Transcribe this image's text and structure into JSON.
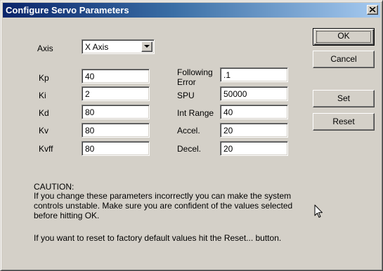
{
  "window": {
    "title": "Configure Servo Parameters"
  },
  "axis": {
    "label": "Axis",
    "value": "X Axis"
  },
  "left_params": [
    {
      "label": "Kp",
      "value": "40"
    },
    {
      "label": "Ki",
      "value": "2"
    },
    {
      "label": "Kd",
      "value": "80"
    },
    {
      "label": "Kv",
      "value": "80"
    },
    {
      "label": "Kvff",
      "value": "80"
    }
  ],
  "right_params": [
    {
      "label_line1": "Following",
      "label_line2": "Error",
      "value": ".1"
    },
    {
      "label": "SPU",
      "value": "50000"
    },
    {
      "label": "Int Range",
      "value": "40"
    },
    {
      "label": "Accel.",
      "value": "20"
    },
    {
      "label": "Decel.",
      "value": "20"
    }
  ],
  "buttons": {
    "ok": "OK",
    "cancel": "Cancel",
    "set": "Set",
    "reset": "Reset"
  },
  "caution": {
    "heading": "CAUTION:",
    "line1": "If you change these parameters incorrectly you can make the system",
    "line2": "controls unstable. Make sure you are confident of the values selected",
    "line3": "before hitting OK.",
    "line4": "If you want to reset to factory default values hit the Reset... button."
  },
  "icons": {
    "close": "close-icon",
    "dropdown": "chevron-down-icon",
    "cursor": "mouse-pointer-icon"
  },
  "colors": {
    "dialog_face": "#d4d0c8",
    "title_start": "#0a246a",
    "title_end": "#a6caf0",
    "field_bg": "#ffffff"
  }
}
